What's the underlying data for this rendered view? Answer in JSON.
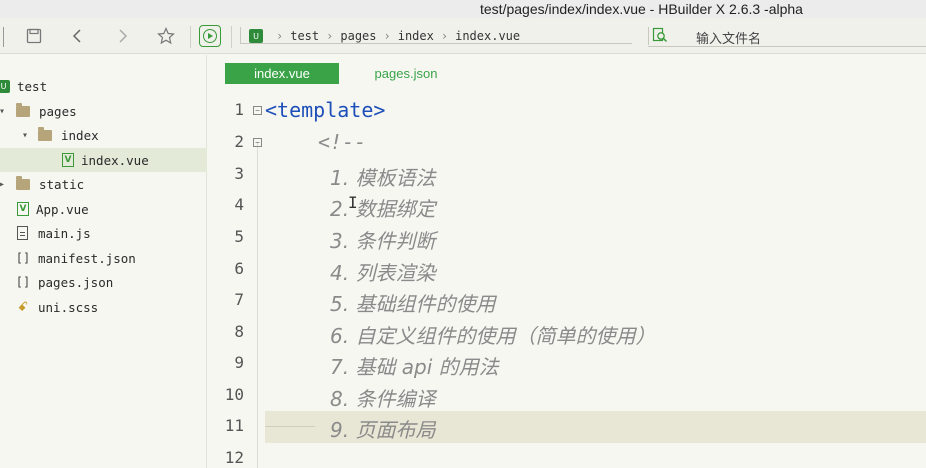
{
  "window": {
    "title": "test/pages/index/index.vue - HBuilder X 2.6.3 -alpha"
  },
  "toolbar": {
    "breadcrumb_badge": "U",
    "breadcrumb": [
      "test",
      "pages",
      "index",
      "index.vue"
    ],
    "search_placeholder": "输入文件名"
  },
  "sidebar": {
    "items": [
      {
        "label": "test",
        "icon": "uniapp-project-icon",
        "expander": ""
      },
      {
        "label": "pages",
        "icon": "folder-icon",
        "expander": "▾"
      },
      {
        "label": "index",
        "icon": "folder-icon",
        "expander": "▾"
      },
      {
        "label": "index.vue",
        "icon": "vue-file-icon",
        "expander": ""
      },
      {
        "label": "static",
        "icon": "folder-icon",
        "expander": "▸"
      },
      {
        "label": "App.vue",
        "icon": "vue-file-icon",
        "expander": ""
      },
      {
        "label": "main.js",
        "icon": "js-file-icon",
        "expander": ""
      },
      {
        "label": "manifest.json",
        "icon": "json-file-icon",
        "expander": ""
      },
      {
        "label": "pages.json",
        "icon": "json-file-icon",
        "expander": ""
      },
      {
        "label": "uni.scss",
        "icon": "scss-file-icon",
        "expander": ""
      }
    ],
    "selected": "index.vue"
  },
  "tabs": [
    {
      "label": "index.vue",
      "active": true
    },
    {
      "label": "pages.json",
      "active": false
    }
  ],
  "editor": {
    "lines": [
      {
        "n": "1",
        "text": "<template>",
        "kind": "tag",
        "fold": "⊟"
      },
      {
        "n": "2",
        "text": "<!--",
        "kind": "comment",
        "fold": "⊟"
      },
      {
        "n": "3",
        "text": "1. 模板语法",
        "kind": "item",
        "fold": ""
      },
      {
        "n": "4",
        "text": "2. 数据绑定",
        "kind": "item",
        "fold": ""
      },
      {
        "n": "5",
        "text": "3. 条件判断",
        "kind": "item",
        "fold": ""
      },
      {
        "n": "6",
        "text": "4. 列表渲染",
        "kind": "item",
        "fold": ""
      },
      {
        "n": "7",
        "text": "5. 基础组件的使用",
        "kind": "item",
        "fold": ""
      },
      {
        "n": "8",
        "text": "6. 自定义组件的使用（简单的使用）",
        "kind": "item",
        "fold": ""
      },
      {
        "n": "9",
        "text": "7. 基础 api 的用法",
        "kind": "item",
        "fold": ""
      },
      {
        "n": "10",
        "text": "8. 条件编译",
        "kind": "item",
        "fold": ""
      },
      {
        "n": "11",
        "text": "9. 页面布局",
        "kind": "item",
        "fold": ""
      },
      {
        "n": "12",
        "text": "",
        "kind": "item",
        "fold": ""
      }
    ],
    "highlighted_line": "11"
  }
}
